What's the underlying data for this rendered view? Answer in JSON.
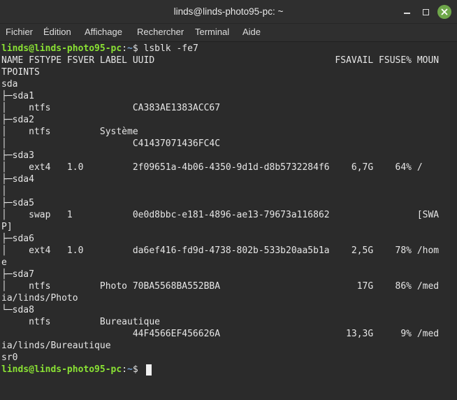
{
  "window": {
    "title": "linds@linds-photo95-pc: ~",
    "buttons": {
      "minimize": "minimize-icon",
      "maximize": "maximize-icon",
      "close": "close-icon"
    },
    "close_color": "#6fa74a"
  },
  "menu": [
    "Fichier",
    "Édition",
    "Affichage",
    "Rechercher",
    "Terminal",
    "Aide"
  ],
  "prompt": {
    "user_host": "linds@linds-photo95-pc",
    "sep": ":",
    "path": "~",
    "symbol": "$ "
  },
  "colors": {
    "prompt_user": "#8ae234",
    "prompt_path": "#729fcf",
    "background": "#2b2b2b",
    "text": "#e6e6e6"
  },
  "command": "lsblk -fe7",
  "output": {
    "header": "NAME FSTYPE FSVER LABEL UUID                                 FSAVAIL FSUSE% MOUN",
    "header_wrap": "TPOINTS",
    "rows": [
      "sda",
      "├─sda1",
      "│    ntfs               CA383AE1383ACC67",
      "├─sda2",
      "│    ntfs         Système",
      "│                       C41437071436FC4C",
      "├─sda3",
      "│    ext4   1.0         2f09651a-4b06-4350-9d1d-d8b5732284f6    6,7G    64% /",
      "├─sda4",
      "│",
      "├─sda5",
      "│    swap   1           0e0d8bbc-e181-4896-ae13-79673a116862                [SWA",
      "P]",
      "├─sda6",
      "│    ext4   1.0         da6ef416-fd9d-4738-802b-533b20aa5b1a    2,5G    78% /hom",
      "e",
      "├─sda7",
      "│    ntfs         Photo 70BA5568BA552BBA                         17G    86% /med",
      "ia/linds/Photo",
      "└─sda8",
      "     ntfs         Bureautique",
      "                        44F4566EF456626A                       13,3G     9% /med",
      "ia/linds/Bureautique",
      "sr0"
    ]
  }
}
